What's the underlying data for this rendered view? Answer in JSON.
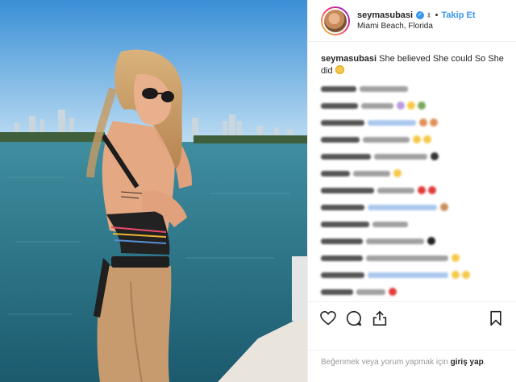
{
  "post": {
    "username": "seymasubasi",
    "follow_label": "Takip Et",
    "location": "Miami Beach, Florida",
    "bullet": "•"
  },
  "caption": {
    "username": "seymasubasi",
    "text": "She believed She could So She did"
  },
  "comments": [
    {
      "u": 44,
      "t": 60,
      "emojis": []
    },
    {
      "u": 46,
      "t": 40,
      "emojis": [
        "#b89be0",
        "#f7c948",
        "#7aa85a"
      ]
    },
    {
      "u": 54,
      "t": 60,
      "link": true,
      "emojis": [
        "#e0915a",
        "#e0915a"
      ]
    },
    {
      "u": 48,
      "t": 58,
      "emojis": [
        "#f7c948",
        "#f7c948"
      ]
    },
    {
      "u": 62,
      "t": 66,
      "emojis": [
        "#333"
      ]
    },
    {
      "u": 36,
      "t": 46,
      "emojis": [
        "#f7c948"
      ]
    },
    {
      "u": 66,
      "t": 46,
      "emojis": [
        "#e23b3b",
        "#e23b3b"
      ]
    },
    {
      "u": 54,
      "t": 86,
      "link": true,
      "emojis": [
        "#c9905c"
      ]
    },
    {
      "u": 60,
      "t": 44,
      "emojis": []
    },
    {
      "u": 52,
      "t": 72,
      "emojis": [
        "#222"
      ]
    },
    {
      "u": 52,
      "t": 102,
      "emojis": [
        "#f7c948"
      ]
    },
    {
      "u": 54,
      "t": 100,
      "link": true,
      "emojis": [
        "#f7c948",
        "#f7c948"
      ]
    },
    {
      "u": 40,
      "t": 36,
      "emojis": [
        "#e23b3b"
      ]
    }
  ],
  "footer": {
    "login_prompt": "Beğenmek veya yorum yapmak için",
    "login_link": "giriş yap",
    "period": "."
  },
  "icons": [
    "verified-badge-icon",
    "more-icon",
    "heart-icon",
    "comment-icon",
    "share-icon",
    "bookmark-icon"
  ]
}
